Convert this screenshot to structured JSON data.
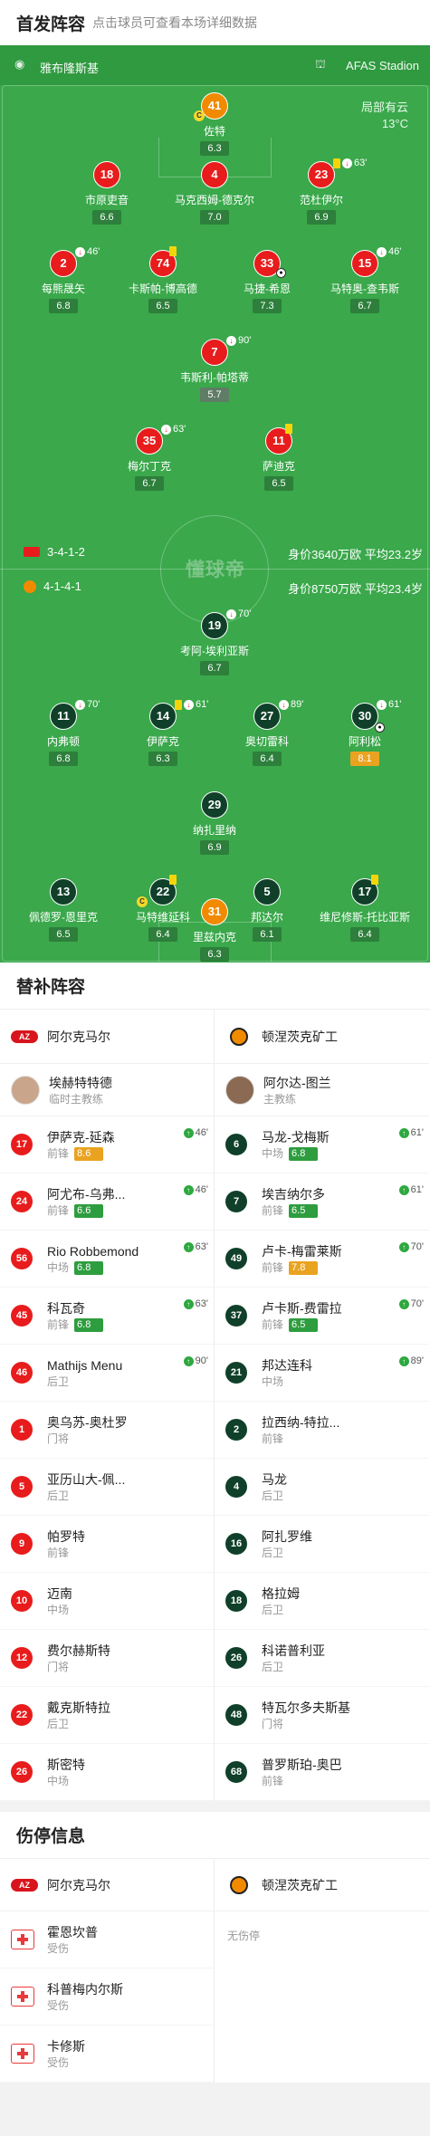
{
  "lineup": {
    "title": "首发阵容",
    "hint": "点击球员可查看本场详细数据",
    "home_team": "雅布隆斯基",
    "venue": "AFAS Stadion",
    "weather": "局部有云",
    "temp": "13°C",
    "watermark": "懂球帝",
    "home_formation": "3-4-1-2",
    "home_value": "身价3640万欧 平均23.2岁",
    "away_formation": "4-1-4-1",
    "away_value": "身价8750万欧 平均23.4岁",
    "players": [
      {
        "n": "41",
        "name": "佐特",
        "r": "6.3"
      },
      {
        "n": "18",
        "name": "市原吏音",
        "r": "6.6"
      },
      {
        "n": "4",
        "name": "马克西姆-德克尔",
        "r": "7.0"
      },
      {
        "n": "23",
        "name": "范杜伊尔",
        "r": "6.9",
        "ev": "63'"
      },
      {
        "n": "2",
        "name": "每熊晟矢",
        "r": "6.8",
        "ev": "46'"
      },
      {
        "n": "74",
        "name": "卡斯帕-博高德",
        "r": "6.5"
      },
      {
        "n": "33",
        "name": "马捷-希恩",
        "r": "7.3"
      },
      {
        "n": "15",
        "name": "马特奥-查韦斯",
        "r": "6.7",
        "ev": "46'"
      },
      {
        "n": "7",
        "name": "韦斯利-帕塔蒂",
        "r": "5.7",
        "ev": "90'"
      },
      {
        "n": "35",
        "name": "梅尔丁克",
        "r": "6.7",
        "ev": "63'"
      },
      {
        "n": "11",
        "name": "萨迪克",
        "r": "6.5"
      },
      {
        "n": "19",
        "name": "考阿-埃利亚斯",
        "r": "6.7",
        "ev": "70'"
      },
      {
        "n": "11",
        "name": "内弗顿",
        "r": "6.8",
        "ev": "70'"
      },
      {
        "n": "14",
        "name": "伊萨克",
        "r": "6.3",
        "ev": "61'"
      },
      {
        "n": "27",
        "name": "奥切雷科",
        "r": "6.4",
        "ev": "89'"
      },
      {
        "n": "30",
        "name": "阿利松",
        "r": "8.1",
        "ev": "61'"
      },
      {
        "n": "29",
        "name": "纳扎里纳",
        "r": "6.9"
      },
      {
        "n": "13",
        "name": "佩德罗-恩里克",
        "r": "6.5"
      },
      {
        "n": "22",
        "name": "马特维延科",
        "r": "6.4"
      },
      {
        "n": "5",
        "name": "邦达尔",
        "r": "6.1"
      },
      {
        "n": "17",
        "name": "维尼修斯-托比亚斯",
        "r": "6.4"
      },
      {
        "n": "31",
        "name": "里兹内克",
        "r": "6.3"
      }
    ]
  },
  "subs": {
    "title": "替补阵容",
    "home": {
      "team": "阿尔克马尔",
      "coach": "埃赫特特德",
      "coach_role": "临时主教练",
      "players": [
        {
          "n": "17",
          "name": "伊萨克-延森",
          "pos": "前锋",
          "r": "8.6",
          "ev": "46'"
        },
        {
          "n": "24",
          "name": "阿尤布-乌弗...",
          "pos": "前锋",
          "r": "6.6",
          "ev": "46'"
        },
        {
          "n": "56",
          "name": "Rio Robbemond",
          "pos": "中场",
          "r": "6.8",
          "ev": "63'"
        },
        {
          "n": "45",
          "name": "科瓦奇",
          "pos": "前锋",
          "r": "6.8",
          "ev": "63'"
        },
        {
          "n": "46",
          "name": "Mathijs Menu",
          "pos": "后卫",
          "ev": "90'"
        },
        {
          "n": "1",
          "name": "奥乌苏-奥杜罗",
          "pos": "门将"
        },
        {
          "n": "5",
          "name": "亚历山大-佩...",
          "pos": "后卫"
        },
        {
          "n": "9",
          "name": "帕罗特",
          "pos": "前锋"
        },
        {
          "n": "10",
          "name": "迈南",
          "pos": "中场"
        },
        {
          "n": "12",
          "name": "费尔赫斯特",
          "pos": "门将"
        },
        {
          "n": "22",
          "name": "戴克斯特拉",
          "pos": "后卫"
        },
        {
          "n": "26",
          "name": "斯密特",
          "pos": "中场"
        }
      ]
    },
    "away": {
      "team": "顿涅茨克矿工",
      "coach": "阿尔达-图兰",
      "coach_role": "主教练",
      "players": [
        {
          "n": "6",
          "name": "马龙-戈梅斯",
          "pos": "中场",
          "r": "6.8",
          "ev": "61'"
        },
        {
          "n": "7",
          "name": "埃吉纳尔多",
          "pos": "前锋",
          "r": "6.5",
          "ev": "61'"
        },
        {
          "n": "49",
          "name": "卢卡-梅雷莱斯",
          "pos": "前锋",
          "r": "7.8",
          "ev": "70'"
        },
        {
          "n": "37",
          "name": "卢卡斯-费雷拉",
          "pos": "前锋",
          "r": "6.5",
          "ev": "70'"
        },
        {
          "n": "21",
          "name": "邦达连科",
          "pos": "中场",
          "ev": "89'"
        },
        {
          "n": "2",
          "name": "拉西纳-特拉...",
          "pos": "前锋"
        },
        {
          "n": "4",
          "name": "马龙",
          "pos": "后卫"
        },
        {
          "n": "16",
          "name": "阿扎罗维",
          "pos": "后卫"
        },
        {
          "n": "18",
          "name": "格拉姆",
          "pos": "后卫"
        },
        {
          "n": "26",
          "name": "科诺普利亚",
          "pos": "后卫"
        },
        {
          "n": "48",
          "name": "特瓦尔多夫斯基",
          "pos": "门将"
        },
        {
          "n": "68",
          "name": "普罗斯珀-奥巴",
          "pos": "前锋"
        }
      ]
    }
  },
  "injuries": {
    "title": "伤停信息",
    "home_team": "阿尔克马尔",
    "away_team": "顿涅茨克矿工",
    "none": "无伤停",
    "players": [
      {
        "name": "霍恩坎普",
        "status": "受伤"
      },
      {
        "name": "科普梅内尔斯",
        "status": "受伤"
      },
      {
        "name": "卡修斯",
        "status": "受伤"
      }
    ]
  },
  "colors": {
    "pitch": "#3aa84b",
    "home": "#e81c1c",
    "away": "#10402a",
    "gk": "#f28a00",
    "rating": "#2d7f3b",
    "rating_high": "#e9a320"
  }
}
